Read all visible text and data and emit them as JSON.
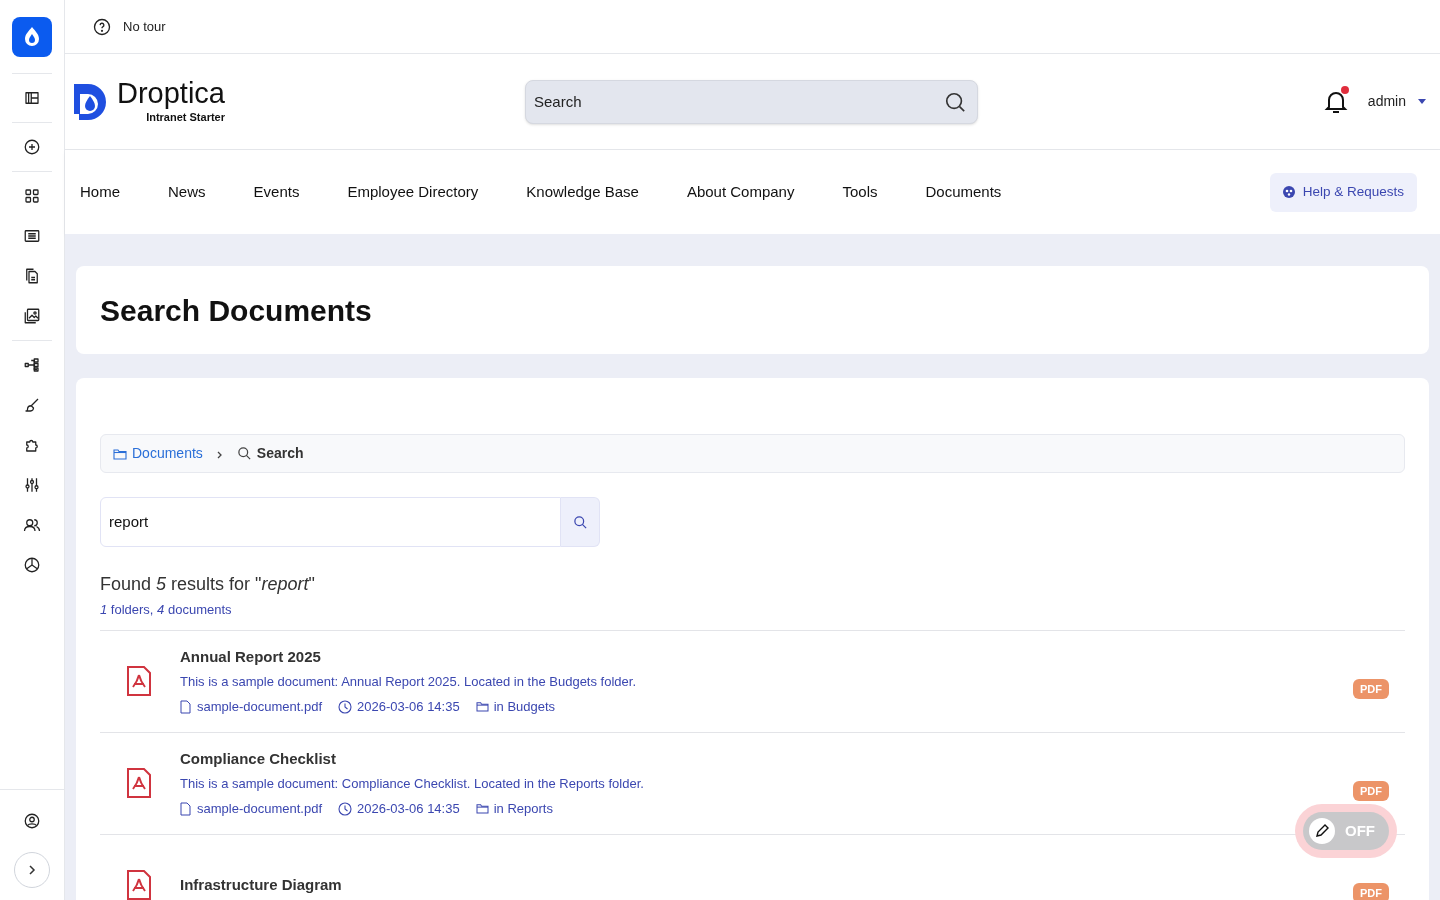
{
  "toolbar": {
    "tour": "No tour"
  },
  "header": {
    "brand": "Droptica",
    "subtitle": "Intranet Starter",
    "search": {
      "placeholder": "Search"
    },
    "notifications": true,
    "user": "admin"
  },
  "nav": {
    "items": [
      "Home",
      "News",
      "Events",
      "Employee Directory",
      "Knowledge Base",
      "About Company",
      "Tools",
      "Documents"
    ],
    "help": "Help & Requests"
  },
  "page_title": "Search Documents",
  "breadcrumb": [
    {
      "label": "Documents",
      "kind": "folder"
    },
    {
      "label": "Search",
      "kind": "search"
    }
  ],
  "search_field": {
    "value": "report"
  },
  "summary": {
    "text": "Found *5* results for \"*report*\"",
    "counts": "*1* folders, *4* documents"
  },
  "results": [
    {
      "title": "Annual Report 2025",
      "description": "This is a sample document: Annual Report 2025. Located in the Budgets folder.",
      "file": "sample-document.pdf",
      "date": "2026-03-06 14:35",
      "folder": "in Budgets",
      "badge": "PDF"
    },
    {
      "title": "Compliance Checklist",
      "description": "This is a sample document: Compliance Checklist. Located in the Reports folder.",
      "file": "sample-document.pdf",
      "date": "2026-03-06 14:35",
      "folder": "in Reports",
      "badge": "PDF"
    },
    {
      "title": "Infrastructure Diagram",
      "badge": "PDF"
    }
  ],
  "edit_toggle": {
    "label": "OFF",
    "on": false
  }
}
